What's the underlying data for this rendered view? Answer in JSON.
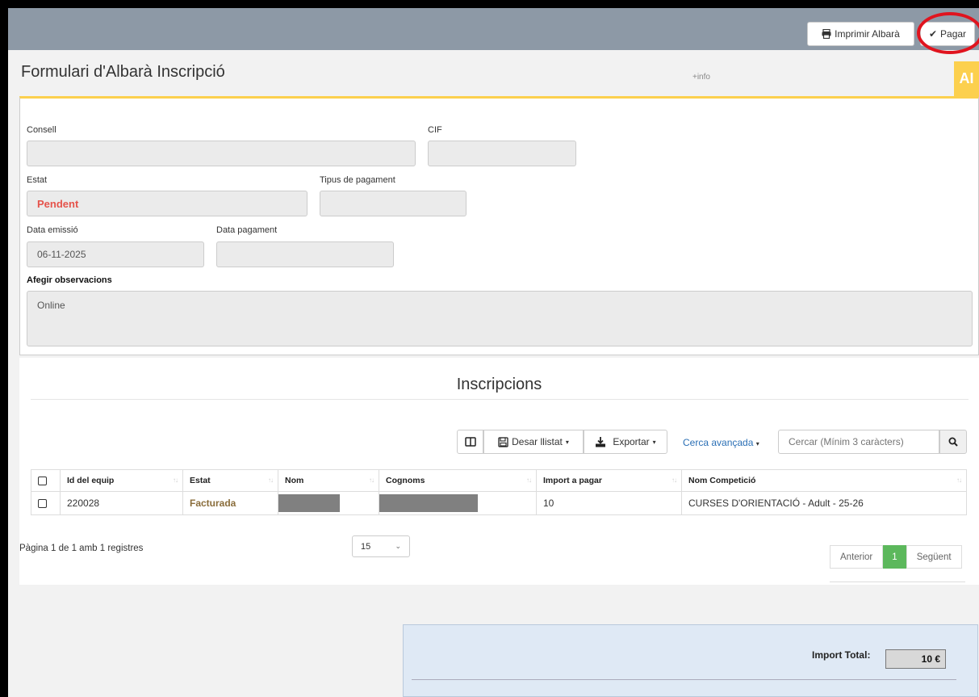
{
  "toolbar": {
    "print_label": "Imprimir Albarà",
    "pay_label": "Pagar"
  },
  "header": {
    "title": "Formulari d'Albarà Inscripció",
    "info_link": "+info",
    "ai_badge": "AI"
  },
  "form": {
    "consell": {
      "label": "Consell",
      "value": ""
    },
    "cif": {
      "label": "CIF",
      "value": ""
    },
    "estat": {
      "label": "Estat",
      "value": "Pendent"
    },
    "tipus_pagament": {
      "label": "Tipus de pagament",
      "value": ""
    },
    "data_emissio": {
      "label": "Data emissió",
      "value": "06-11-2025"
    },
    "data_pagament": {
      "label": "Data pagament",
      "value": ""
    },
    "observacions": {
      "label": "Afegir observacions",
      "value": "Online"
    }
  },
  "inscripcions": {
    "title": "Inscripcions",
    "tools": {
      "save_list": "Desar llistat",
      "export": "Exportar",
      "advanced_search": "Cerca avançada",
      "search_placeholder": "Cercar (Mínim 3 caràcters)"
    },
    "columns": [
      "Id del equip",
      "Estat",
      "Nom",
      "Cognoms",
      "Import a pagar",
      "Nom Competició"
    ],
    "rows": [
      {
        "id": "220028",
        "estat": "Facturada",
        "nom": "",
        "cognoms": "",
        "import": "10",
        "competicio": "CURSES D'ORIENTACIÓ - Adult - 25-26"
      }
    ],
    "pager": {
      "info": "Pàgina 1 de 1 amb 1 registres",
      "page_size": "15",
      "prev": "Anterior",
      "current": "1",
      "next": "Següent"
    }
  },
  "total": {
    "label": "Import Total:",
    "value": "10 €"
  },
  "colors": {
    "topbar": "#8d99a6",
    "accent_yellow": "#fcd04e",
    "pendent_red": "#e5534b",
    "facturada_brown": "#8a6d3b",
    "active_page_green": "#5cb85c",
    "highlight_circle": "#e0141e"
  }
}
